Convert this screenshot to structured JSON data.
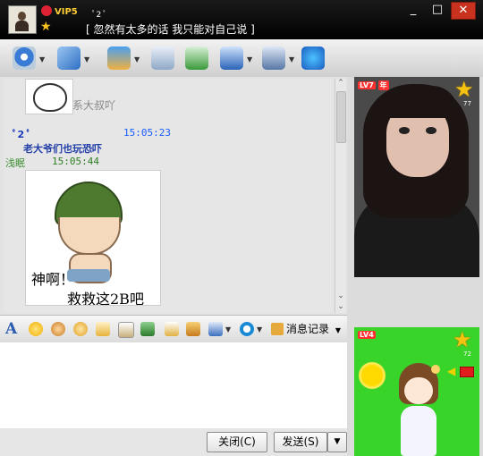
{
  "titlebar": {
    "vip_label": "VIP5",
    "nickname": "ﾟ2 ﾟ",
    "signature": "[ 忽然有太多的话 我只能对自己说 ]",
    "controls": {
      "minimize": "_",
      "maximize": "□",
      "close": "✕"
    }
  },
  "toolbar": {
    "icons": [
      "video-call-icon",
      "voice-call-icon",
      "send-file-icon",
      "email-icon",
      "add-friend-icon",
      "group-icon",
      "settings-icon",
      "app-icon"
    ]
  },
  "chat": {
    "sticker1_caption": "系大叔吖",
    "messages": [
      {
        "sender": "ﾟ2 ﾟ",
        "time": "15:05:23",
        "text": "老大爷们也玩恐吓"
      },
      {
        "sender": "浅眠",
        "time": "15:05:44"
      }
    ],
    "sticker2_line1": "神啊！",
    "sticker2_line2": "救救这2B吧"
  },
  "format_bar": {
    "history_label": "消息记录",
    "font_label": "A"
  },
  "input": {
    "value": ""
  },
  "buttons": {
    "close": "关闭(C)",
    "send": "发送(S)",
    "send_dropdown": "▼"
  },
  "right": {
    "photo_level": "LV7",
    "photo_level_suffix": "年",
    "photo_star_count": "77",
    "show_level": "LV4",
    "show_star_count": "72"
  },
  "colors": {
    "title_bg": "#000000",
    "sender_blue": "#1c39bb",
    "me_green": "#3a8f2e",
    "close_red": "#c8321e",
    "show_bg": "#39d42a"
  }
}
